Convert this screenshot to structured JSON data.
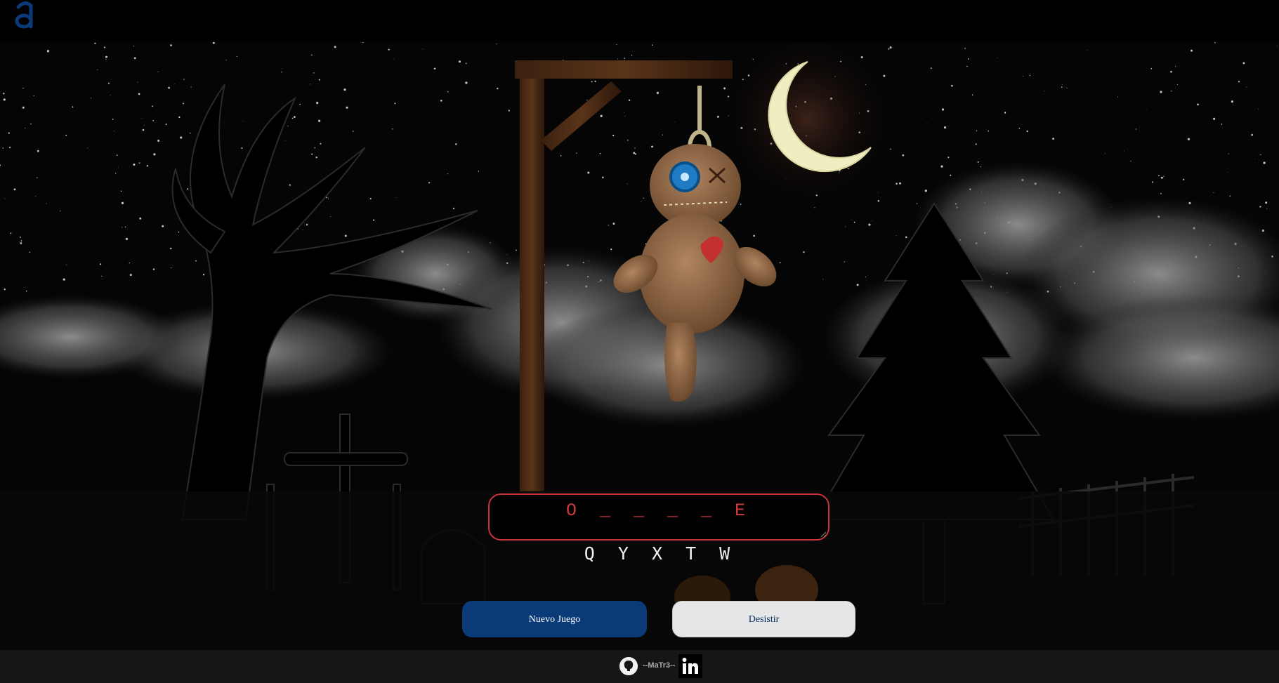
{
  "app": {
    "logo_letter": "a",
    "logo_color": "#0a3a78"
  },
  "game": {
    "word_display": "O _ _ _ _ E",
    "wrong_letters": "Q Y X T W",
    "accent_red": "#c8343a"
  },
  "buttons": {
    "new_game_label": "Nuevo Juego",
    "quit_label": "Desistir",
    "primary_color": "#0a3a78",
    "secondary_color": "#e6e6e8"
  },
  "footer": {
    "author": "--MaTr3--",
    "github_icon": "github-icon",
    "linkedin_icon": "linkedin-icon"
  }
}
